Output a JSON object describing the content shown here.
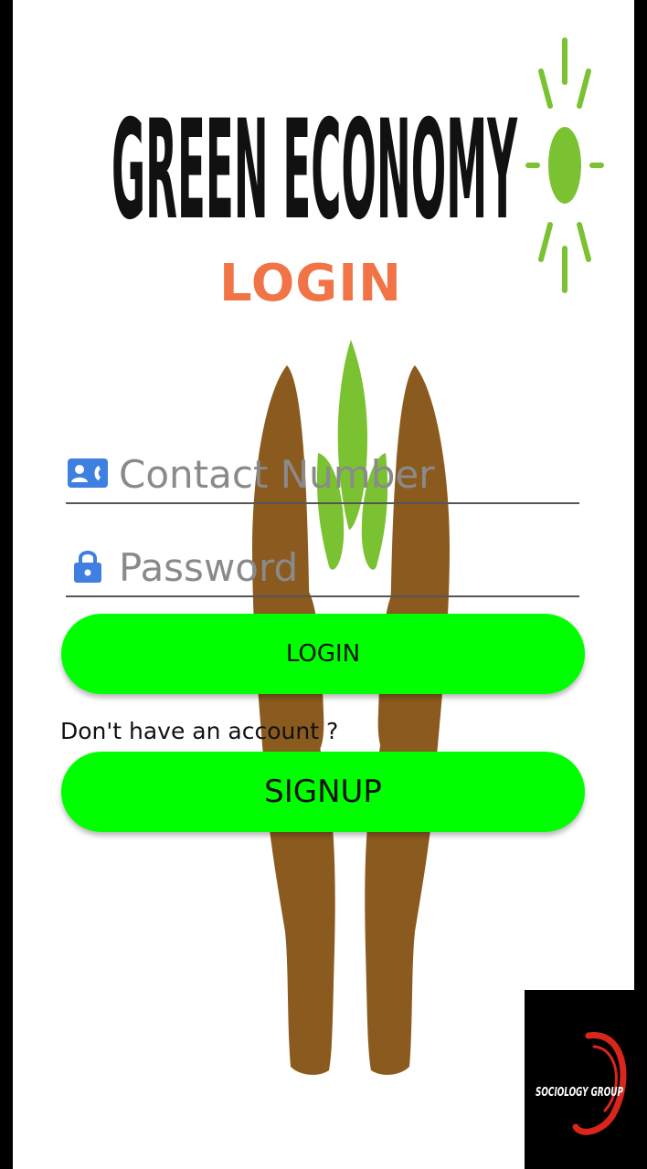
{
  "brand": {
    "title": "GREEN ECONOMY",
    "title_color": "#111111",
    "sun_color": "#7ac231"
  },
  "heading": {
    "text": "LOGIN",
    "color": "#f07446"
  },
  "form": {
    "contact": {
      "placeholder": "Contact Number",
      "value": "",
      "icon": "contact-card-icon"
    },
    "password": {
      "placeholder": "Password",
      "value": "",
      "icon": "lock-icon"
    },
    "icon_color": "#3f7fe0"
  },
  "buttons": {
    "login_label": "LOGIN",
    "signup_label": "SIGNUP",
    "color": "#00ff00"
  },
  "signup_prompt": "Don't have an account ?",
  "sponsor": {
    "logo_text": "SOCIOLOGY GROUP",
    "ring_color": "#d8261c"
  },
  "background_art": {
    "hands_color": "#8b5a1e",
    "leaf_color": "#7ac231"
  }
}
